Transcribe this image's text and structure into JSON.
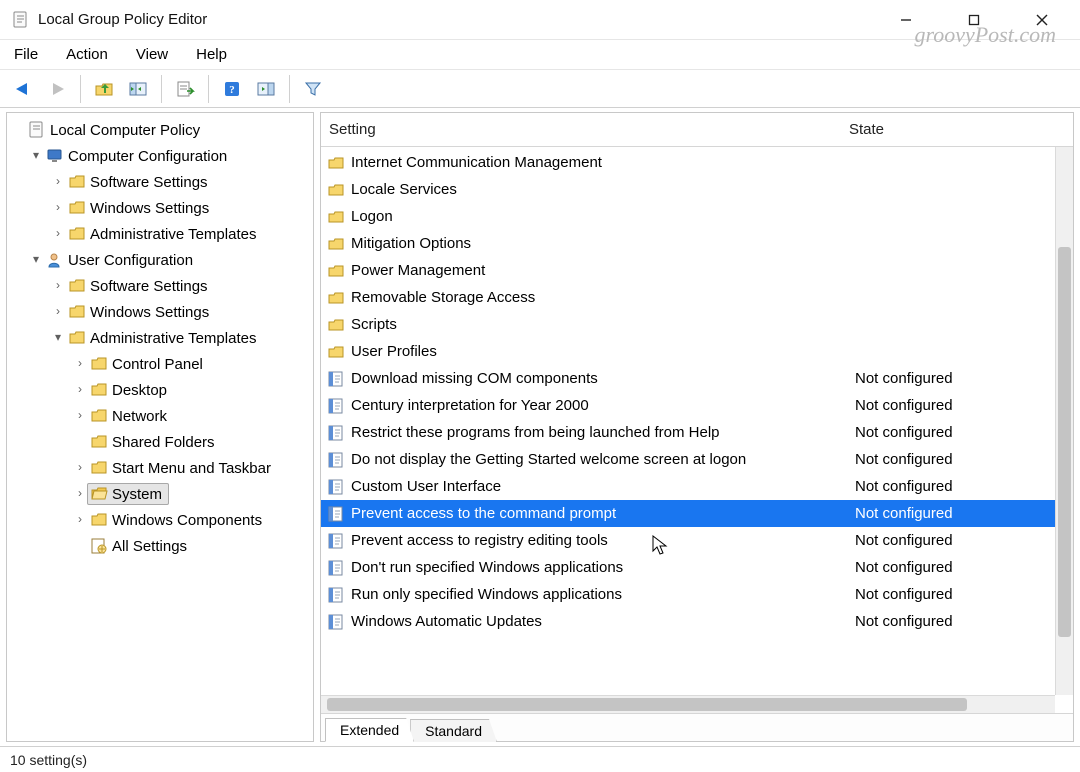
{
  "window": {
    "title": "Local Group Policy Editor",
    "watermark": "groovyPost.com"
  },
  "menu": [
    "File",
    "Action",
    "View",
    "Help"
  ],
  "columns": {
    "setting": "Setting",
    "state": "State"
  },
  "tabs": [
    "Extended",
    "Standard"
  ],
  "status": "10 setting(s)",
  "tree": {
    "root": "Local Computer Policy",
    "computer": {
      "label": "Computer Configuration",
      "children": [
        "Software Settings",
        "Windows Settings",
        "Administrative Templates"
      ]
    },
    "user": {
      "label": "User Configuration",
      "software": "Software Settings",
      "windows": "Windows Settings",
      "admin": {
        "label": "Administrative Templates",
        "children": [
          "Control Panel",
          "Desktop",
          "Network",
          "Shared Folders",
          "Start Menu and Taskbar",
          "System",
          "Windows Components",
          "All Settings"
        ]
      }
    }
  },
  "settings_folders": [
    "Internet Communication Management",
    "Locale Services",
    "Logon",
    "Mitigation Options",
    "Power Management",
    "Removable Storage Access",
    "Scripts",
    "User Profiles"
  ],
  "settings_items": [
    {
      "name": "Download missing COM components",
      "state": "Not configured"
    },
    {
      "name": "Century interpretation for Year 2000",
      "state": "Not configured"
    },
    {
      "name": "Restrict these programs from being launched from Help",
      "state": "Not configured"
    },
    {
      "name": "Do not display the Getting Started welcome screen at logon",
      "state": "Not configured"
    },
    {
      "name": "Custom User Interface",
      "state": "Not configured"
    },
    {
      "name": "Prevent access to the command prompt",
      "state": "Not configured",
      "selected": true
    },
    {
      "name": "Prevent access to registry editing tools",
      "state": "Not configured"
    },
    {
      "name": "Don't run specified Windows applications",
      "state": "Not configured"
    },
    {
      "name": "Run only specified Windows applications",
      "state": "Not configured"
    },
    {
      "name": "Windows Automatic Updates",
      "state": "Not configured"
    }
  ],
  "toolbar_icons": [
    "back",
    "forward",
    "up",
    "show-hide-tree",
    "export-list",
    "help",
    "show-hide-action-pane",
    "filter"
  ]
}
